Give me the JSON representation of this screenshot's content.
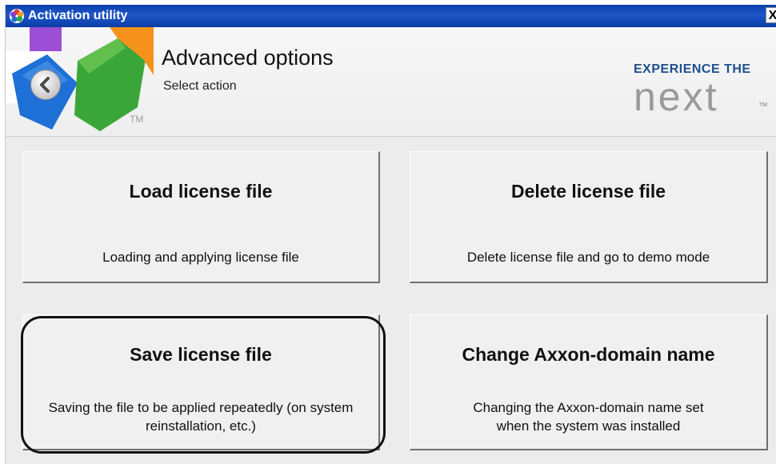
{
  "window": {
    "title": "Activation utility",
    "close_label": "X"
  },
  "header": {
    "title": "Advanced options",
    "subtitle": "Select action",
    "logo_tm": "TM",
    "back_icon": "chevron-left-icon"
  },
  "brand": {
    "tagline": "EXPERIENCE THE",
    "word": "next",
    "tm": "TM"
  },
  "actions": [
    {
      "title": "Load license file",
      "description": "Loading and applying license file"
    },
    {
      "title": "Delete license file",
      "description": "Delete license file and go to demo mode"
    },
    {
      "title": "Save license file",
      "description": "Saving the file to be applied repeatedly (on system reinstallation, etc.)"
    },
    {
      "title": "Change Axxon-domain name",
      "description": "Changing the Axxon-domain name set when the system was installed"
    }
  ],
  "colors": {
    "titlebar": "#1e57c8",
    "brand_blue": "#1d4f8e",
    "brand_gray": "#9a9a9a"
  }
}
